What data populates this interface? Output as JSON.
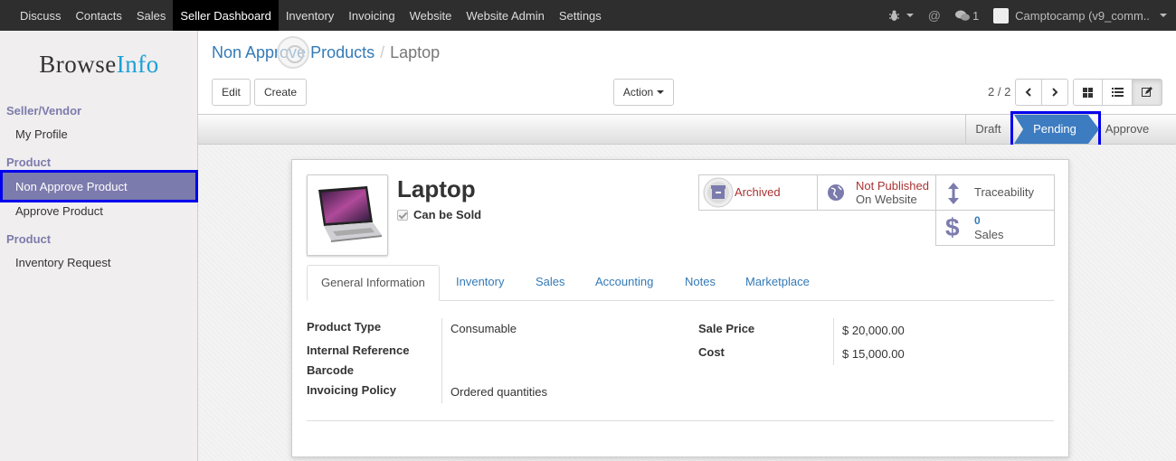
{
  "topmenu": [
    "Discuss",
    "Contacts",
    "Sales",
    "Seller Dashboard",
    "Inventory",
    "Invoicing",
    "Website",
    "Website Admin",
    "Settings"
  ],
  "topbar_right": {
    "messages_count": "1",
    "company": "Camptocamp (v9_comm.."
  },
  "logo": {
    "part1": "Browse",
    "part2": "Info"
  },
  "sidebar": {
    "section1": "Seller/Vendor",
    "my_profile": "My Profile",
    "section2": "Product",
    "non_approve": "Non Approve Product",
    "approve": "Approve Product",
    "section3": "Product",
    "inventory_request": "Inventory Request"
  },
  "breadcrumb": {
    "parent": "Non Approve Products",
    "separator": "/",
    "current": "Laptop"
  },
  "buttons": {
    "edit": "Edit",
    "create": "Create",
    "action": "Action"
  },
  "pager": "2 / 2",
  "status": {
    "draft": "Draft",
    "pending": "Pending",
    "approve": "Approve"
  },
  "product": {
    "name": "Laptop",
    "can_be_sold": "Can be Sold"
  },
  "smart_buttons": {
    "archived": "Archived",
    "not_published": "Not Published",
    "on_website": "On Website",
    "traceability": "Traceability",
    "sales_count": "0",
    "sales": "Sales"
  },
  "tabs": [
    "General Information",
    "Inventory",
    "Sales",
    "Accounting",
    "Notes",
    "Marketplace"
  ],
  "fields": {
    "product_type_label": "Product Type",
    "product_type": "Consumable",
    "internal_ref_label": "Internal Reference",
    "barcode_label": "Barcode",
    "invoicing_policy_label": "Invoicing Policy",
    "invoicing_policy": "Ordered quantities",
    "sale_price_label": "Sale Price",
    "sale_price": "$ 20,000.00",
    "cost_label": "Cost",
    "cost": "$ 15,000.00"
  },
  "colors": {
    "accent": "#7c7bad",
    "link": "#337ab7",
    "highlight": "#0000ee",
    "status_active": "#3d7cc0"
  }
}
